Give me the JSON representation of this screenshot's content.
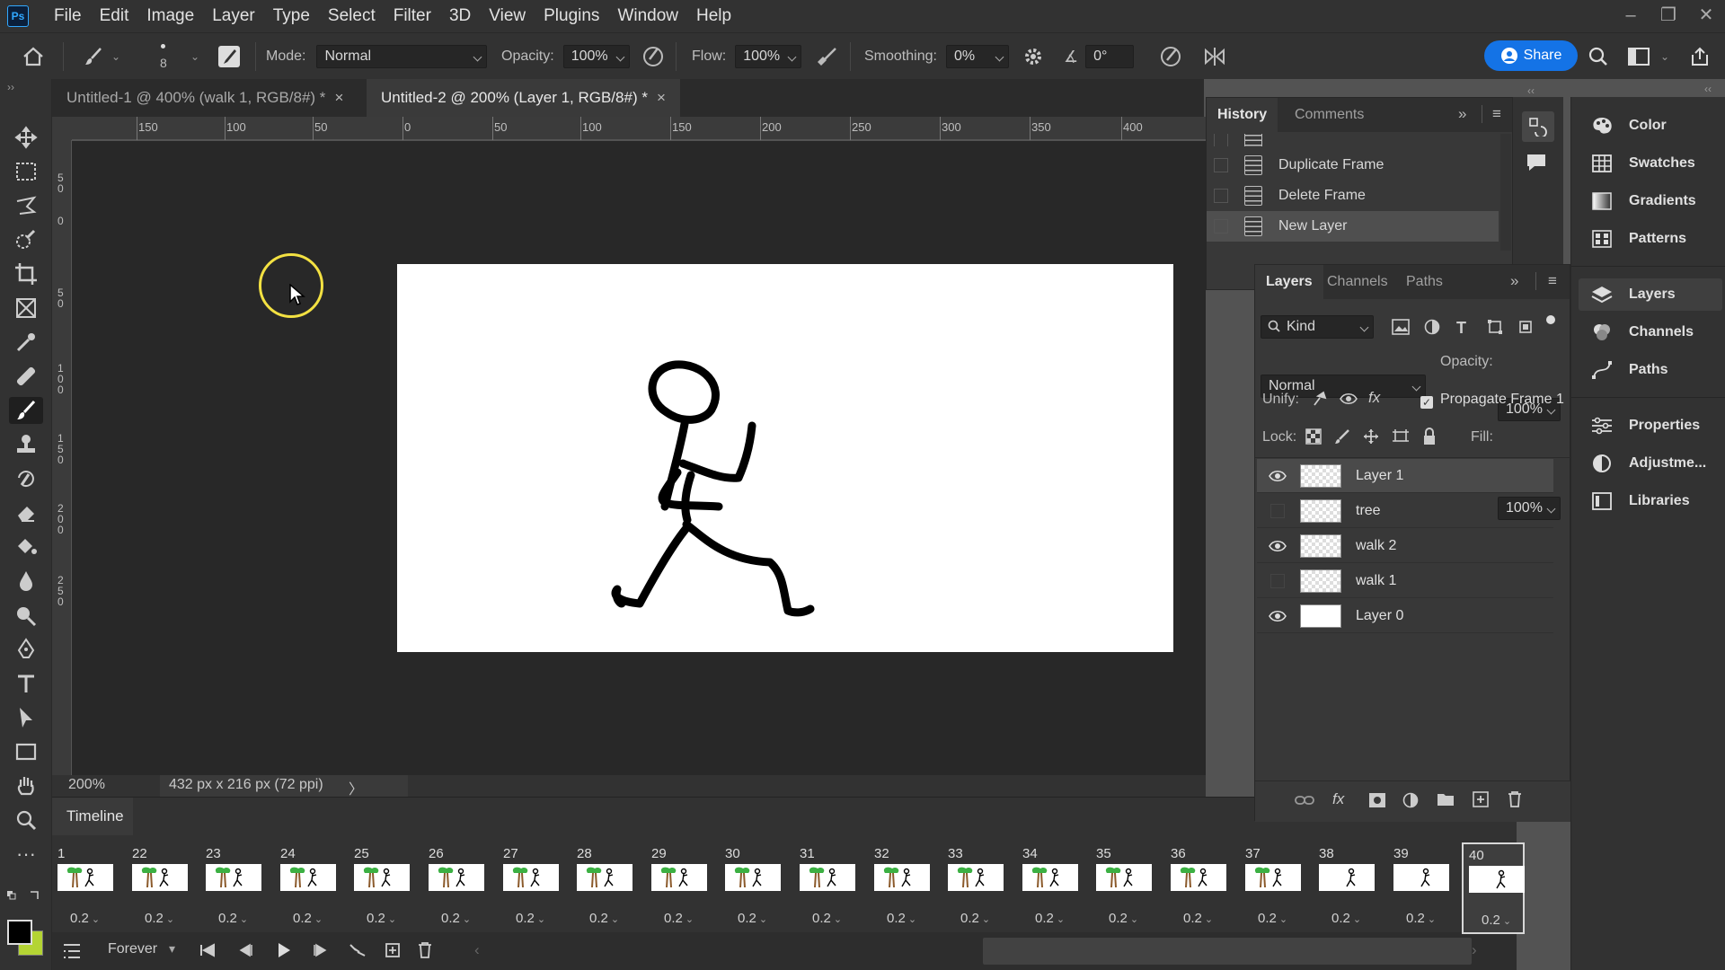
{
  "app": {
    "logo": "Ps"
  },
  "menu": [
    "File",
    "Edit",
    "Image",
    "Layer",
    "Type",
    "Select",
    "Filter",
    "3D",
    "View",
    "Plugins",
    "Window",
    "Help"
  ],
  "options": {
    "brush_size": "8",
    "mode_label": "Mode:",
    "mode_value": "Normal",
    "opacity_label": "Opacity:",
    "opacity_value": "100%",
    "flow_label": "Flow:",
    "flow_value": "100%",
    "smoothing_label": "Smoothing:",
    "smoothing_value": "0%",
    "angle_value": "0°",
    "share_label": "Share"
  },
  "tabs": [
    {
      "label": "Untitled-1 @ 400% (walk 1, RGB/8#) *",
      "close": "×"
    },
    {
      "label": "Untitled-2 @ 200% (Layer 1, RGB/8#) *",
      "close": "×"
    }
  ],
  "ruler_h": [
    "150",
    "100",
    "50",
    "0",
    "50",
    "100",
    "150",
    "200",
    "250",
    "300",
    "350",
    "400"
  ],
  "ruler_v": [
    "50",
    "0",
    "50",
    "100",
    "150",
    "200",
    "250"
  ],
  "status": {
    "zoom": "200%",
    "doc_info": "432 px x 216 px (72 ppi)",
    "arrow": "〉"
  },
  "timeline": {
    "title": "Timeline",
    "loop": "Forever",
    "frames": [
      {
        "n": "1",
        "d": "0.2",
        "type": "tree"
      },
      {
        "n": "22",
        "d": "0.2",
        "type": "tree"
      },
      {
        "n": "23",
        "d": "0.2",
        "type": "tree"
      },
      {
        "n": "24",
        "d": "0.2",
        "type": "tree"
      },
      {
        "n": "25",
        "d": "0.2",
        "type": "tree"
      },
      {
        "n": "26",
        "d": "0.2",
        "type": "tree"
      },
      {
        "n": "27",
        "d": "0.2",
        "type": "tree"
      },
      {
        "n": "28",
        "d": "0.2",
        "type": "tree"
      },
      {
        "n": "29",
        "d": "0.2",
        "type": "tree"
      },
      {
        "n": "30",
        "d": "0.2",
        "type": "tree"
      },
      {
        "n": "31",
        "d": "0.2",
        "type": "tree"
      },
      {
        "n": "32",
        "d": "0.2",
        "type": "tree"
      },
      {
        "n": "33",
        "d": "0.2",
        "type": "tree"
      },
      {
        "n": "34",
        "d": "0.2",
        "type": "tree"
      },
      {
        "n": "35",
        "d": "0.2",
        "type": "tree"
      },
      {
        "n": "36",
        "d": "0.2",
        "type": "tree"
      },
      {
        "n": "37",
        "d": "0.2",
        "type": "tree"
      },
      {
        "n": "38",
        "d": "0.2",
        "type": "walk"
      },
      {
        "n": "39",
        "d": "0.2",
        "type": "walk"
      },
      {
        "n": "40",
        "d": "0.2",
        "type": "walk",
        "selected": true
      }
    ]
  },
  "history": {
    "tabs": [
      "History",
      "Comments"
    ],
    "items": [
      "Duplicate Frame",
      "Delete Frame",
      "New Layer"
    ]
  },
  "layers": {
    "tabs": [
      "Layers",
      "Channels",
      "Paths"
    ],
    "filter": "Kind",
    "blend": "Normal",
    "opacity_label": "Opacity:",
    "opacity_value": "100%",
    "unify_label": "Unify:",
    "propagate_label": "Propagate Frame 1",
    "lock_label": "Lock:",
    "fill_label": "Fill:",
    "fill_value": "100%",
    "items": [
      {
        "name": "Layer 1",
        "visible": true,
        "selected": true
      },
      {
        "name": "tree",
        "visible": false
      },
      {
        "name": "walk 2",
        "visible": true
      },
      {
        "name": "walk 1",
        "visible": false
      },
      {
        "name": "Layer 0",
        "visible": true,
        "white": true
      }
    ]
  },
  "dock": {
    "group1": [
      "Color",
      "Swatches",
      "Gradients",
      "Patterns"
    ],
    "group2": [
      "Layers",
      "Channels",
      "Paths"
    ],
    "group3": [
      "Properties",
      "Adjustme...",
      "Libraries"
    ]
  },
  "colors": {
    "accent": "#1473e6",
    "cursor_ring": "#f3e142",
    "background_swatch": "#b4d434"
  }
}
